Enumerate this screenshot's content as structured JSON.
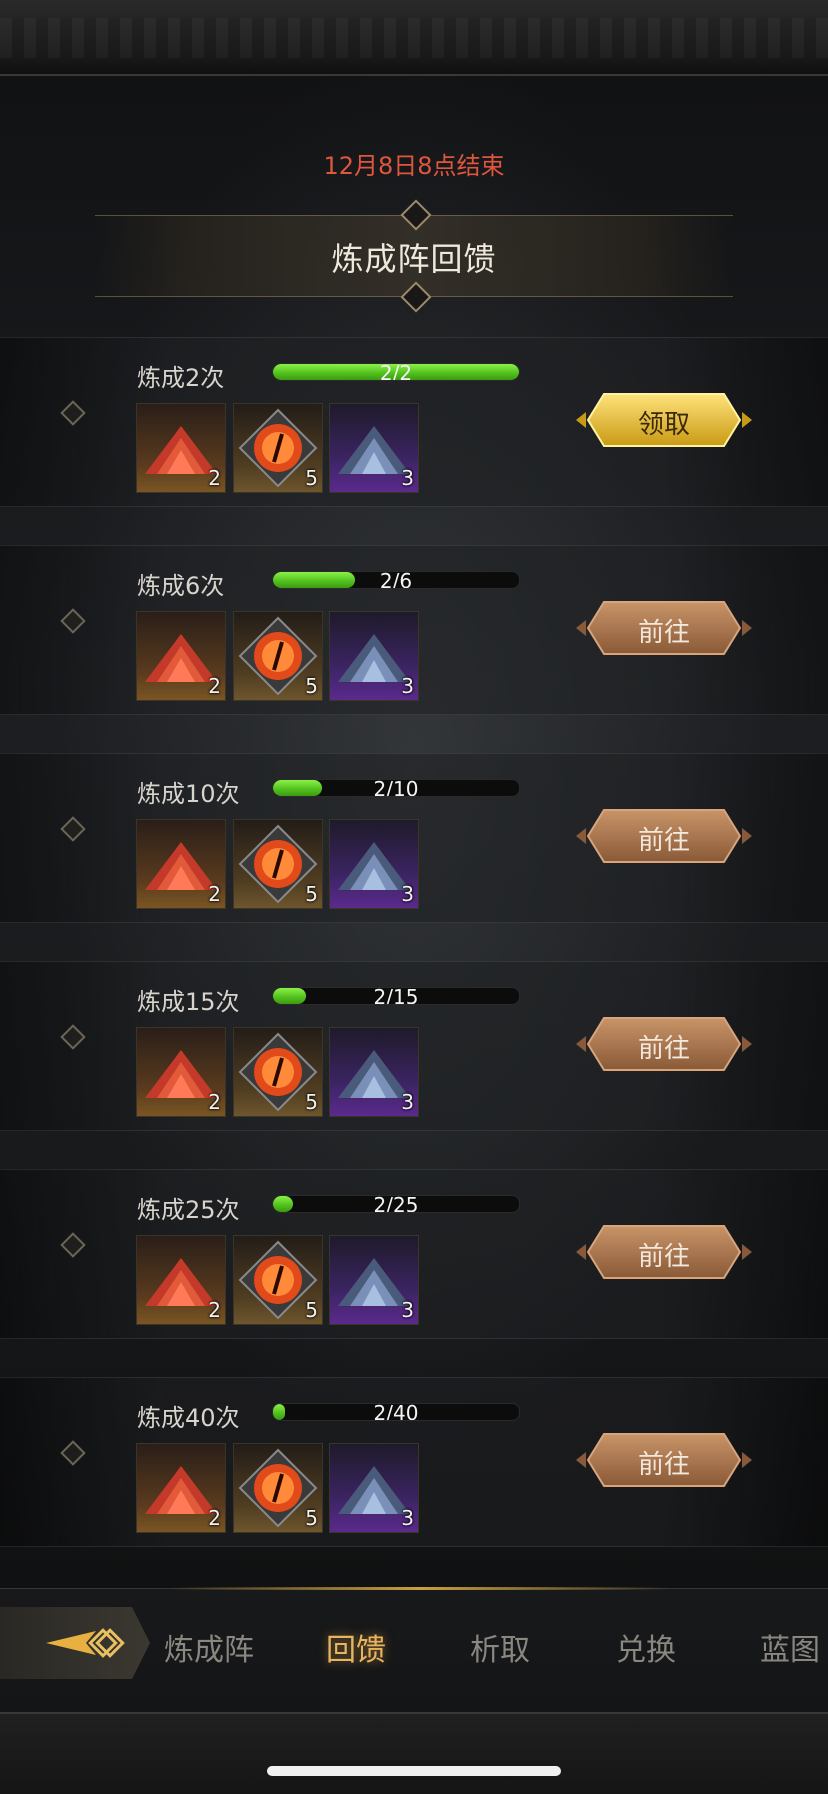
{
  "event": {
    "end_time": "12月8日8点结束",
    "title": "炼成阵回馈"
  },
  "tasks": [
    {
      "title": "炼成2次",
      "progress": "2/2",
      "fraction": 1.0,
      "button": "领取",
      "state": "claim"
    },
    {
      "title": "炼成6次",
      "progress": "2/6",
      "fraction": 0.333,
      "button": "前往",
      "state": "go"
    },
    {
      "title": "炼成10次",
      "progress": "2/10",
      "fraction": 0.2,
      "button": "前往",
      "state": "go"
    },
    {
      "title": "炼成15次",
      "progress": "2/15",
      "fraction": 0.133,
      "button": "前往",
      "state": "go"
    },
    {
      "title": "炼成25次",
      "progress": "2/25",
      "fraction": 0.08,
      "button": "前往",
      "state": "go"
    },
    {
      "title": "炼成40次",
      "progress": "2/40",
      "fraction": 0.05,
      "button": "前往",
      "state": "go"
    }
  ],
  "rewards": [
    {
      "icon": "red-crystal-pile-icon",
      "count": "2"
    },
    {
      "icon": "orange-eye-gem-icon",
      "count": "5"
    },
    {
      "icon": "blue-crystal-pile-icon",
      "count": "3"
    }
  ],
  "nav": {
    "back_icon": "back-arrow-icon",
    "tabs": [
      {
        "label": "炼成阵",
        "active": false
      },
      {
        "label": "回馈",
        "active": true
      },
      {
        "label": "析取",
        "active": false
      },
      {
        "label": "兑换",
        "active": false
      },
      {
        "label": "蓝图",
        "active": false
      }
    ]
  },
  "colors": {
    "end_time": "#e0553d",
    "progress_fill": "#5fd02a",
    "claim_button": "#e8c233",
    "go_button": "#b07a52",
    "active_tab": "#e8b460"
  }
}
